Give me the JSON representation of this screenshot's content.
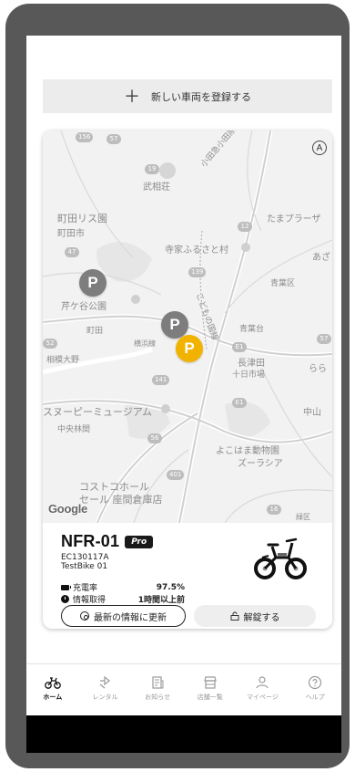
{
  "register": {
    "icon": "plus-icon",
    "label": "新しい車両を登録する"
  },
  "map": {
    "compass_label": "A",
    "google_label": "Google",
    "route_badges": [
      "156",
      "19",
      "57",
      "12",
      "47",
      "139",
      "52",
      "57",
      "E1",
      "E1",
      "141",
      "401",
      "56",
      "16"
    ],
    "labels": {
      "takeda": "武相荘",
      "odakyu": "小田急小田原線",
      "machida_risuen": "町田リス園",
      "machida_city": "町田市",
      "tamaplaza": "たまプラーザ",
      "terrakoya": "寺家ふるさと村",
      "aza": "あざ",
      "aobaku": "青葉区",
      "serigaya": "芹ケ谷公園",
      "kodomonokuni": "こどもの国線",
      "machida": "町田",
      "yokohama_line": "横浜線",
      "aobadai": "青葉台",
      "sagamiono": "相模大野",
      "nagatsuta": "長津田",
      "tokaichiba": "十日市場",
      "rara": "らら",
      "snoopy": "スヌーピーミュージアム",
      "nakayama": "中山",
      "chuorinkan": "中央林間",
      "zoorasia1": "よこはま動物園",
      "zoorasia2": "ズーラシア",
      "costco1": "コストコホール",
      "costco2": "セール 座間倉庫店",
      "midori": "緑区"
    },
    "markers": [
      {
        "label": "P",
        "type": "parking",
        "color": "#7d7d7d"
      },
      {
        "label": "P",
        "type": "parking",
        "color": "#7d7d7d"
      },
      {
        "label": "P",
        "type": "bike",
        "color": "#f2b300"
      }
    ]
  },
  "bike": {
    "name": "NFR-01",
    "badge": "Pro",
    "serial": "EC130117A",
    "nickname": "TestBike 01",
    "battery_label": "充電率",
    "battery_value": "97.5%",
    "updated_label": "情報取得",
    "updated_value": "1時間以上前",
    "update_button": "最新の情報に更新",
    "unlock_button": "解錠する"
  },
  "nav": {
    "items": [
      {
        "label": "ホーム",
        "icon": "bicycle-icon",
        "active": true
      },
      {
        "label": "レンタル",
        "icon": "swap-icon",
        "active": false
      },
      {
        "label": "お知らせ",
        "icon": "news-icon",
        "active": false
      },
      {
        "label": "店舗一覧",
        "icon": "store-icon",
        "active": false
      },
      {
        "label": "マイページ",
        "icon": "person-icon",
        "active": false
      },
      {
        "label": "ヘルプ",
        "icon": "help-icon",
        "active": false
      }
    ]
  },
  "colors": {
    "accent_yellow": "#f2b300",
    "marker_gray": "#7d7d7d",
    "frame": "#585858",
    "text": "#111111"
  }
}
